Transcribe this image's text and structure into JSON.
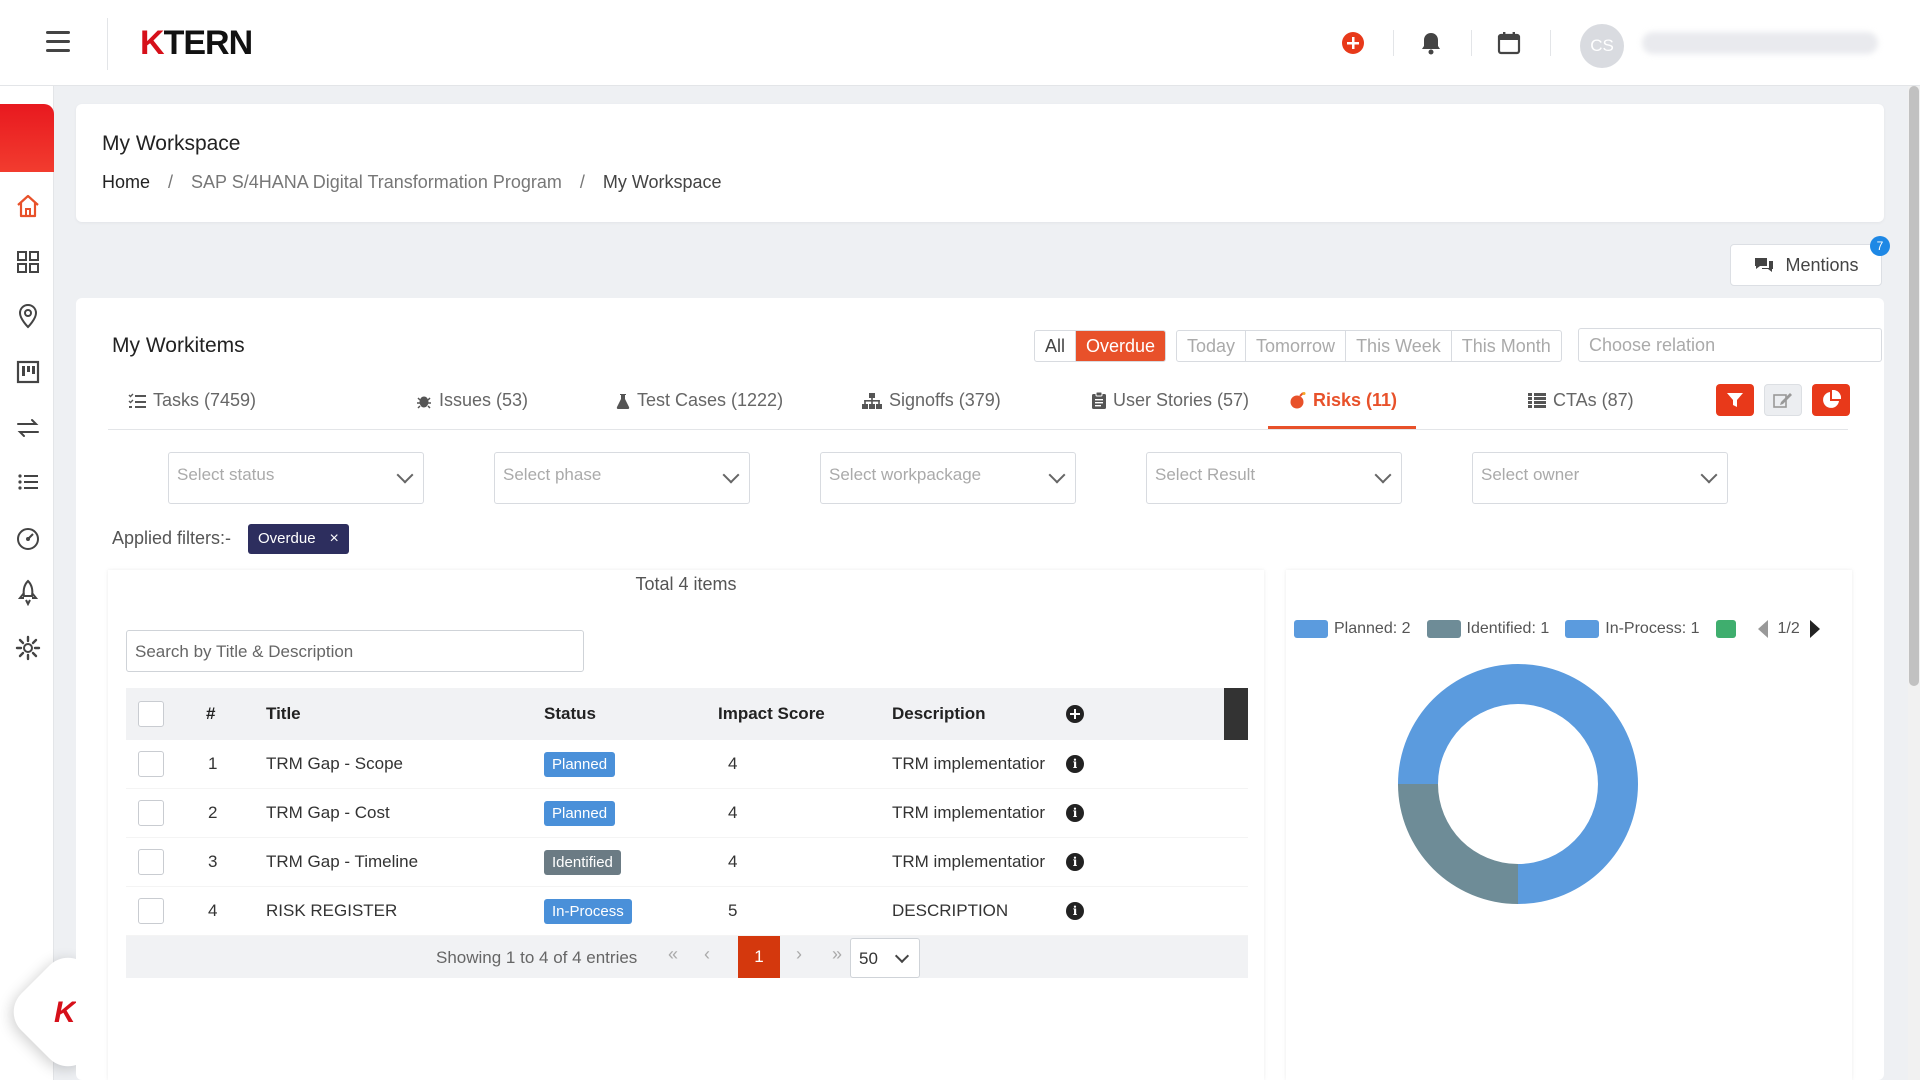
{
  "app": {
    "logo_k": "K",
    "logo_rest": "TERN",
    "avatar_initials": "CS"
  },
  "header": {
    "title": "My Workspace",
    "breadcrumb": {
      "home": "Home",
      "sep": "/",
      "program": "SAP S/4HANA Digital Transformation Program",
      "current": "My Workspace"
    }
  },
  "mentions": {
    "label": "Mentions",
    "count": "7"
  },
  "workitems": {
    "title": "My Workitems",
    "time_filters": {
      "all": "All",
      "overdue": "Overdue",
      "today": "Today",
      "tomorrow": "Tomorrow",
      "this_week": "This Week",
      "this_month": "This Month"
    },
    "relation_placeholder": "Choose relation",
    "tabs": [
      {
        "label": "Tasks (7459)",
        "icon": "list-check-icon"
      },
      {
        "label": "Issues (53)",
        "icon": "bug-icon"
      },
      {
        "label": "Test Cases (1222)",
        "icon": "flask-icon"
      },
      {
        "label": "Signoffs (379)",
        "icon": "sitemap-icon"
      },
      {
        "label": "User Stories (57)",
        "icon": "clipboard-icon"
      },
      {
        "label": "Risks (11)",
        "icon": "bomb-icon"
      },
      {
        "label": "CTAs (87)",
        "icon": "table-list-icon"
      }
    ],
    "filters": {
      "status": "Select status",
      "phase": "Select phase",
      "workpackage": "Select workpackage",
      "result": "Select Result",
      "owner": "Select owner"
    },
    "applied_label": "Applied filters:-",
    "applied_chip": "Overdue",
    "total": "Total 4 items",
    "search_placeholder": "Search by Title & Description",
    "columns": {
      "num": "#",
      "title": "Title",
      "status": "Status",
      "impact": "Impact Score",
      "description": "Description"
    },
    "rows": [
      {
        "num": "1",
        "title": "TRM Gap - Scope",
        "status": "Planned",
        "status_color": "#4a90d9",
        "impact": "4",
        "description": "TRM implementatior"
      },
      {
        "num": "2",
        "title": "TRM Gap - Cost",
        "status": "Planned",
        "status_color": "#4a90d9",
        "impact": "4",
        "description": "TRM implementatior"
      },
      {
        "num": "3",
        "title": "TRM Gap - Timeline",
        "status": "Identified",
        "status_color": "#6b7b84",
        "impact": "4",
        "description": "TRM implementatior"
      },
      {
        "num": "4",
        "title": "RISK REGISTER",
        "status": "In-Process",
        "status_color": "#4a90d9",
        "impact": "5",
        "description": "DESCRIPTION"
      }
    ],
    "pager": {
      "text": "Showing 1 to 4 of 4 entries",
      "first": "«",
      "prev": "‹",
      "current": "1",
      "next": "›",
      "last": "»",
      "page_size": "50"
    }
  },
  "chart_data": {
    "type": "pie",
    "variant": "donut",
    "categories": [
      "Planned",
      "Identified",
      "In-Process"
    ],
    "values": [
      2,
      1,
      1
    ],
    "colors": [
      "#5b9bde",
      "#6e8c97",
      "#5b9bde"
    ],
    "legend": [
      "Planned: 2",
      "Identified: 1",
      "In-Process: 1"
    ],
    "legend_extra_color": "#3fae6e",
    "legend_page": "1/2"
  }
}
